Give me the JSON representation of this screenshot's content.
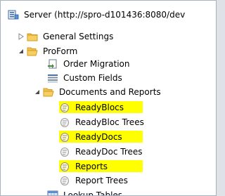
{
  "tree": {
    "root": {
      "label": "Server (http://spro-d101436:8080/dev"
    },
    "general_settings": {
      "label": "General Settings"
    },
    "proform": {
      "label": "ProForm"
    },
    "order_migration": {
      "label": "Order Migration"
    },
    "custom_fields": {
      "label": "Custom Fields"
    },
    "documents_and_reports": {
      "label": "Documents and Reports"
    },
    "readyblocs": {
      "label": "ReadyBlocs",
      "highlight_color": "#ffff00"
    },
    "readybloc_trees": {
      "label": "ReadyBloc Trees"
    },
    "readydocs": {
      "label": "ReadyDocs",
      "highlight_color": "#ffff00"
    },
    "readydoc_trees": {
      "label": "ReadyDoc Trees"
    },
    "reports": {
      "label": "Reports",
      "highlight_color": "#ffff00"
    },
    "report_trees": {
      "label": "Report Trees"
    },
    "lookup_tables": {
      "label": "Lookup Tables"
    }
  },
  "colors": {
    "folder": "#f2c14e",
    "folder_dark": "#d59a1d",
    "highlight": "#ffff00",
    "tree_text": "#000000"
  }
}
